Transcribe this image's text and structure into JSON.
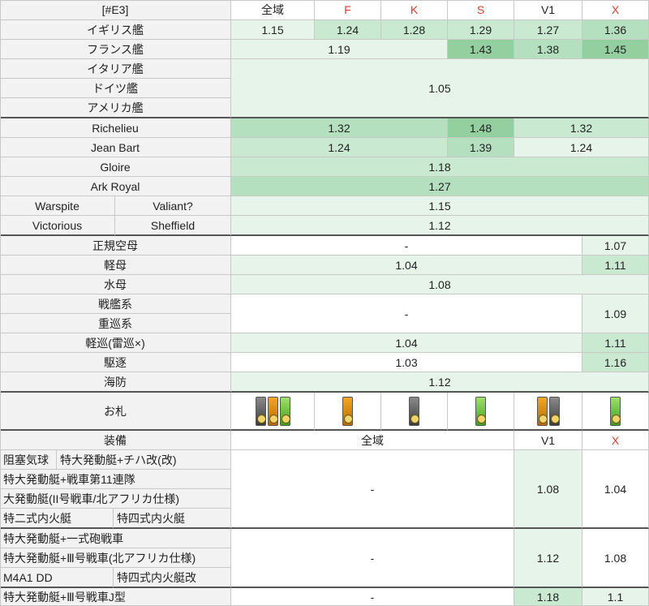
{
  "header": {
    "corner": "[#E3]",
    "cols": [
      "全域",
      "F",
      "K",
      "S",
      "V1",
      "X"
    ],
    "equip_label": "装備",
    "equip_cols": [
      "全域",
      "V1",
      "X"
    ]
  },
  "ships": {
    "uk": {
      "label": "イギリス艦",
      "values": [
        "1.15",
        "1.24",
        "1.28",
        "1.29",
        "1.27",
        "1.36"
      ]
    },
    "fr": {
      "label": "フランス艦",
      "v1": "1.19",
      "v2": "1.43",
      "v3": "1.38",
      "v4": "1.45"
    },
    "it": {
      "label": "イタリア艦"
    },
    "de": {
      "label": "ドイツ艦"
    },
    "us": {
      "label": "アメリカ艦"
    },
    "axis_value": "1.05",
    "richelieu": {
      "label": "Richelieu",
      "v1": "1.32",
      "v2": "1.48",
      "v3": "1.32"
    },
    "jeanbart": {
      "label": "Jean Bart",
      "v1": "1.24",
      "v2": "1.39",
      "v3": "1.24"
    },
    "gloire": {
      "label": "Gloire",
      "value": "1.18"
    },
    "arkroyal": {
      "label": "Ark Royal",
      "value": "1.27"
    },
    "warspite": {
      "label_a": "Warspite",
      "label_b": "Valiant?",
      "value": "1.15"
    },
    "victorious": {
      "label_a": "Victorious",
      "label_b": "Sheffield",
      "value": "1.12"
    }
  },
  "types": {
    "cv": {
      "label": "正規空母",
      "all": "-",
      "x": "1.07"
    },
    "cvl": {
      "label": "軽母",
      "all": "1.04",
      "x": "1.11"
    },
    "av": {
      "label": "水母",
      "all": "1.08"
    },
    "bb": {
      "label": "戦艦系"
    },
    "ca": {
      "label": "重巡系"
    },
    "bbca_all": "-",
    "bbca_x": "1.09",
    "cl": {
      "label": "軽巡(雷巡×)",
      "all": "1.04",
      "x": "1.11"
    },
    "dd": {
      "label": "駆逐",
      "all": "1.03",
      "x": "1.16"
    },
    "de": {
      "label": "海防",
      "all": "1.12"
    }
  },
  "charm_label": "お札",
  "charms": {
    "all": [
      "gray",
      "orange",
      "green"
    ],
    "f": [
      "orange"
    ],
    "k": [
      "gray"
    ],
    "s": [
      "green"
    ],
    "v1": [
      "orange",
      "gray"
    ],
    "x": [
      "green"
    ]
  },
  "equip": {
    "g1": {
      "items": [
        "阻塞気球",
        "特大発動艇+チハ改(改)",
        "特大発動艇+戦車第11連隊",
        "大発動艇(II号戦車/北アフリカ仕様)",
        "特二式内火艇",
        "特四式内火艇"
      ],
      "all": "-",
      "v1": "1.08",
      "x": "1.04"
    },
    "g2": {
      "items": [
        "特大発動艇+一式砲戦車",
        "特大発動艇+Ⅲ号戦車(北アフリカ仕様)",
        "M4A1 DD",
        "特四式内火艇改"
      ],
      "all": "-",
      "v1": "1.12",
      "x": "1.08"
    },
    "g3": {
      "items": [
        "特大発動艇+Ⅲ号戦車J型"
      ],
      "all": "-",
      "v1": "1.18",
      "x": "1.1"
    }
  },
  "colors": {
    "light_green": "#e6f4e9",
    "mid_green": "#c9e9d1",
    "green": "#b5e0c0",
    "dark_green": "#93cf9f",
    "red_text": "#e8372b",
    "gray_bg": "#f2f2f2"
  }
}
